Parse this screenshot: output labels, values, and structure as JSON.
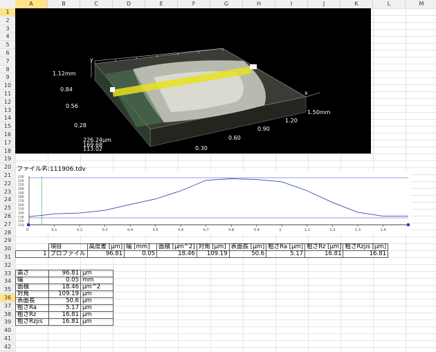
{
  "columns": [
    "A",
    "B",
    "C",
    "D",
    "E",
    "F",
    "G",
    "H",
    "I",
    "J",
    "K",
    "L",
    "M"
  ],
  "rows": [
    "1",
    "2",
    "3",
    "4",
    "5",
    "6",
    "7",
    "8",
    "9",
    "10",
    "11",
    "12",
    "13",
    "14",
    "15",
    "16",
    "17",
    "18",
    "19",
    "20",
    "21",
    "22",
    "23",
    "24",
    "25",
    "26",
    "27",
    "28",
    "29",
    "30",
    "31",
    "32",
    "33",
    "34",
    "35",
    "36",
    "37",
    "38",
    "39",
    "40",
    "41",
    "42"
  ],
  "view3d": {
    "y_axis_label": "y",
    "x_axis_label": "x",
    "z_labels": [
      "1.12mm",
      "0.84",
      "0.56",
      "0.28"
    ],
    "height_readout": [
      "226.24μm",
      "169.68",
      "113.02"
    ],
    "x_labels": [
      "1.50mm",
      "1.20",
      "0.90",
      "0.60",
      "0.30"
    ]
  },
  "file_label": "ファイル名:111906.tdv",
  "chart_data": {
    "type": "line",
    "x": [
      0,
      0.05,
      0.1,
      0.2,
      0.3,
      0.4,
      0.5,
      0.6,
      0.7,
      0.8,
      0.9,
      1.0,
      1.1,
      1.2,
      1.3,
      1.4,
      1.5
    ],
    "values": [
      129,
      132,
      136,
      138,
      145,
      160,
      174,
      195,
      222,
      226,
      224,
      218,
      195,
      165,
      140,
      130,
      130
    ],
    "y_ticks": [
      "230",
      "220",
      "210",
      "200",
      "190",
      "180",
      "170",
      "160",
      "150",
      "140",
      "130",
      "120",
      "110"
    ],
    "x_ticks": [
      "0",
      "0.1",
      "0.2",
      "0.3",
      "0.4",
      "0.5",
      "0.6",
      "0.7",
      "0.8",
      "0.9",
      "1",
      "1.1",
      "1.2",
      "1.3",
      "1.4"
    ],
    "ylim": [
      108,
      232
    ],
    "xlim": [
      0,
      1.5
    ]
  },
  "results_table": {
    "headers": [
      "項目",
      "高度差 [μm]",
      "幅 [mm]",
      "面積 [μm^2]",
      "対角 [μm]",
      "表面長 [μm]",
      "粗さRa [μm]",
      "粗さRz [μm]",
      "粗さRzjis [μm]"
    ],
    "row": [
      "1",
      "プロファイル",
      "96.81",
      "0.05",
      "18.46",
      "109.19",
      "50.6",
      "5.17",
      "16.81",
      "16.81"
    ]
  },
  "summary": [
    {
      "name": "高さ",
      "value": "96.81",
      "unit": "μm"
    },
    {
      "name": "幅",
      "value": "0.05",
      "unit": "mm"
    },
    {
      "name": "面積",
      "value": "18.46",
      "unit": "μm^2"
    },
    {
      "name": "対角",
      "value": "109.19",
      "unit": "μm"
    },
    {
      "name": "表面長",
      "value": "50.6",
      "unit": "μm"
    },
    {
      "name": "粗さRa",
      "value": "5.17",
      "unit": "μm"
    },
    {
      "name": "粗さRz",
      "value": "16.81",
      "unit": "μm"
    },
    {
      "name": "粗さRzjis",
      "value": "16.81",
      "unit": "μm"
    }
  ]
}
